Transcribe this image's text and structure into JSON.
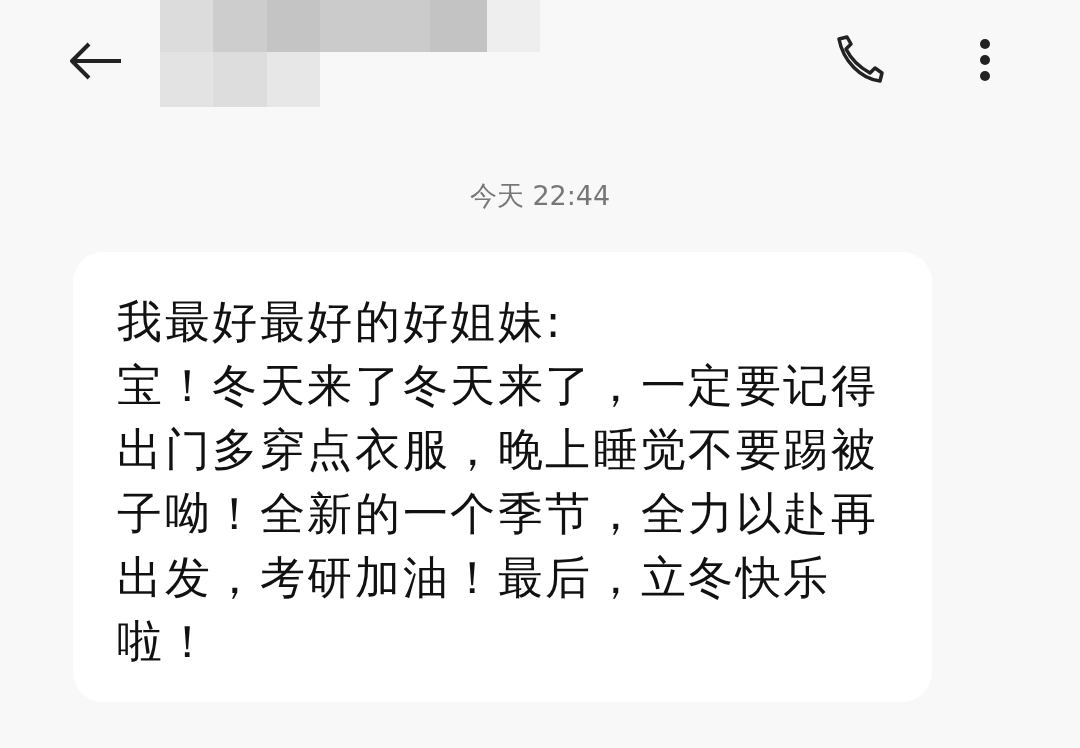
{
  "conversation": {
    "timestamp": "今天 22:44",
    "messages": [
      {
        "kind": "received",
        "text": "我最好最好的好姐妹:\n宝！冬天来了冬天来了，一定要记得出门多穿点衣服，晚上睡觉不要踢被子呦！全新的一个季节，全力以赴再出发，考研加油！最后，立冬快乐啦！"
      }
    ]
  }
}
